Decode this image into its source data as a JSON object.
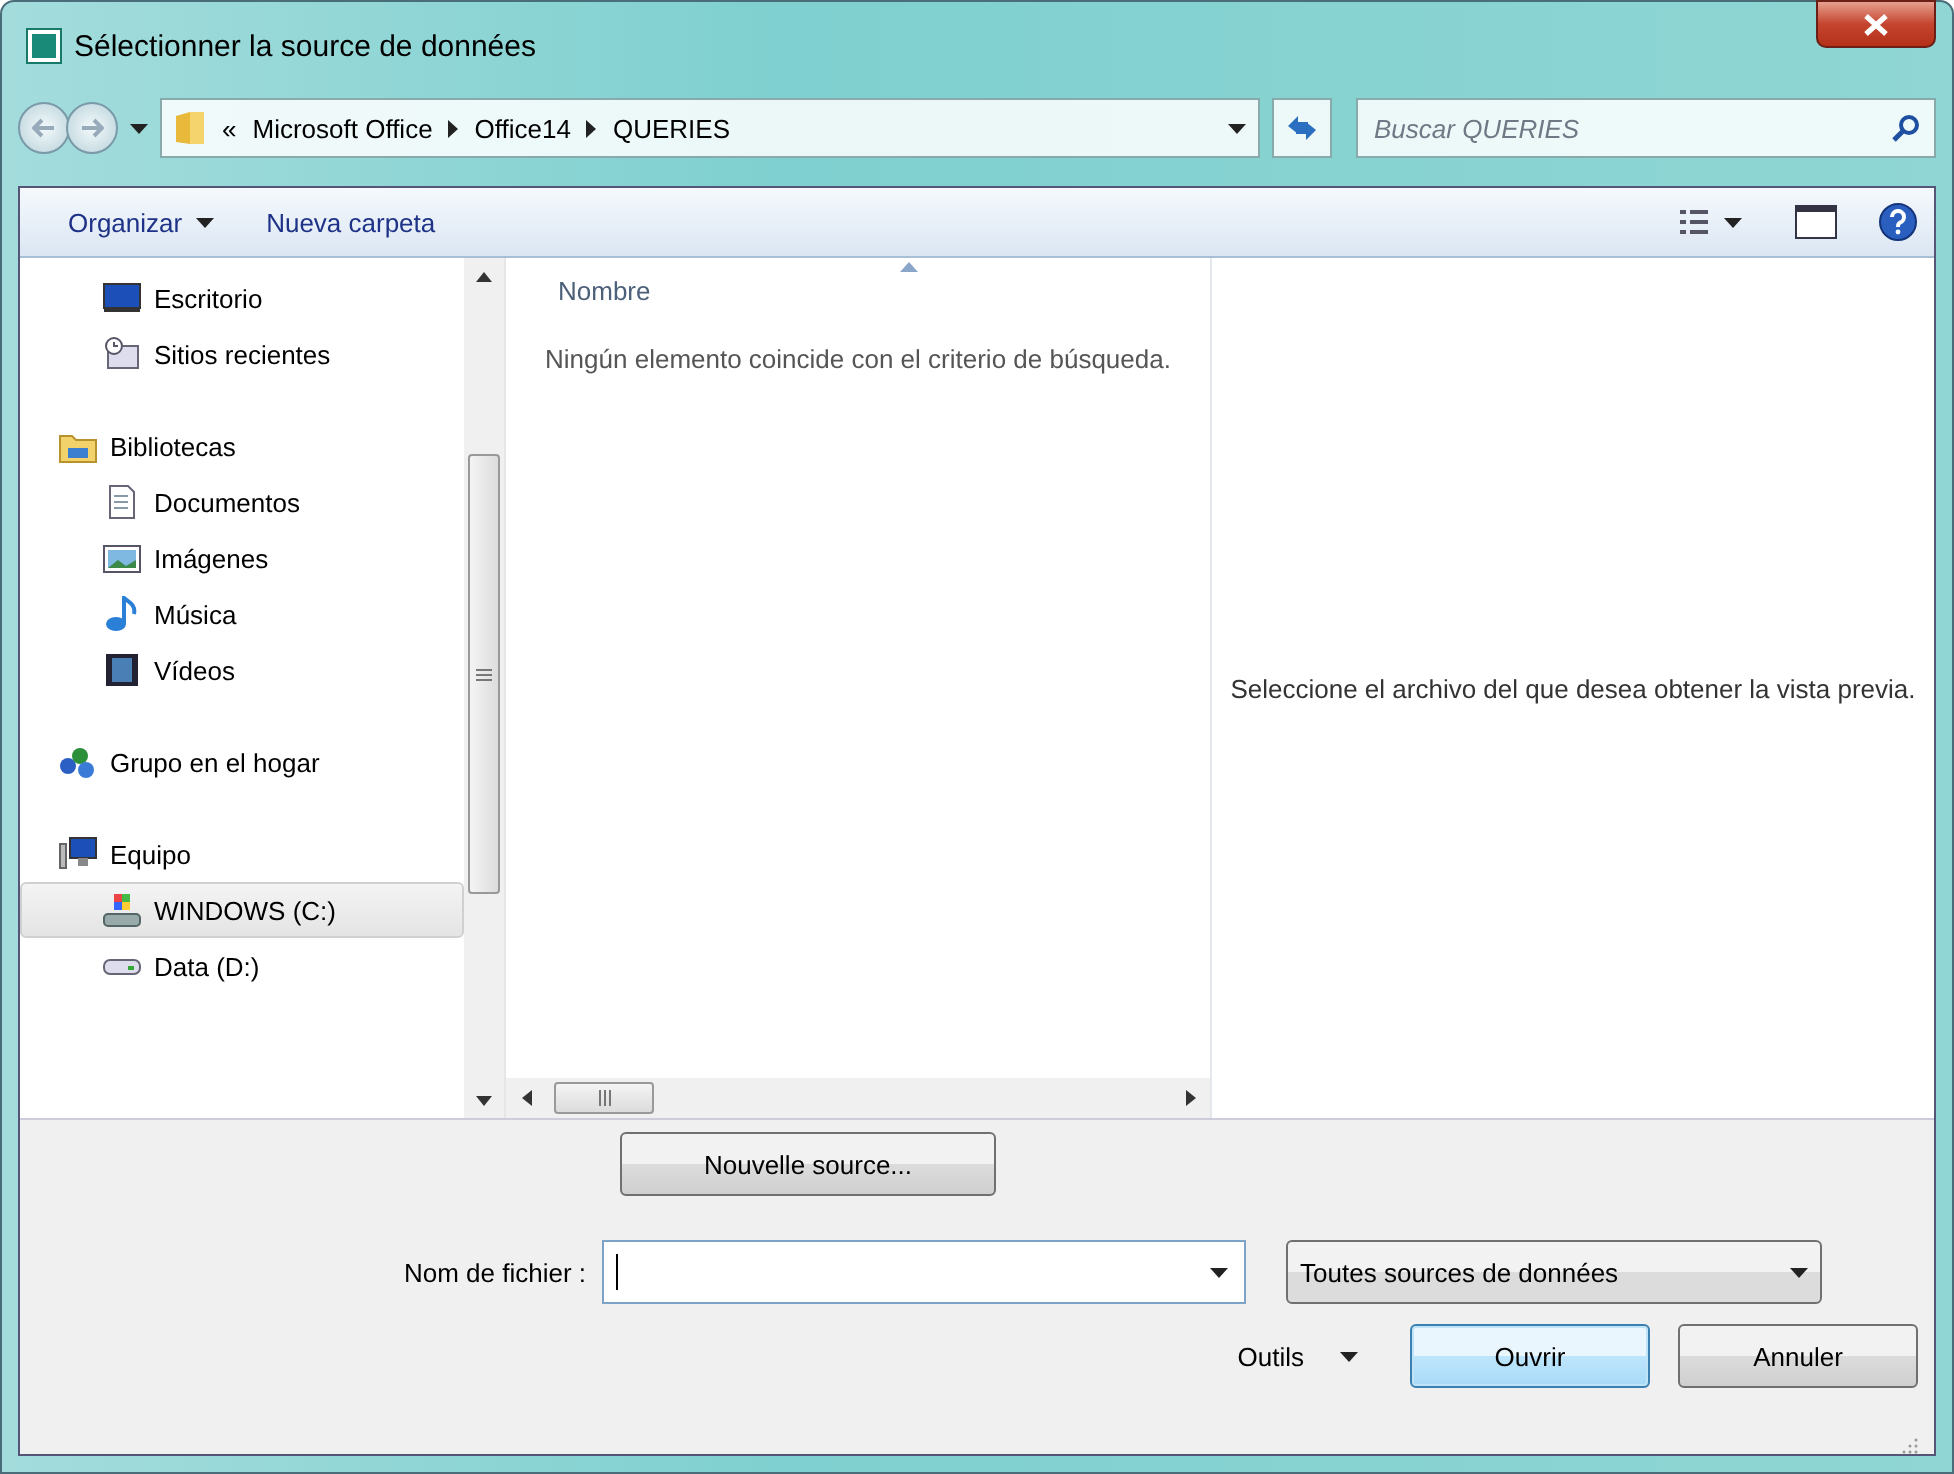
{
  "window": {
    "title": "Sélectionner la source de données"
  },
  "address": {
    "overflow": "«",
    "crumbs": [
      "Microsoft Office",
      "Office14",
      "QUERIES"
    ]
  },
  "search": {
    "placeholder": "Buscar QUERIES"
  },
  "toolbar": {
    "organize": "Organizar",
    "new_folder": "Nueva carpeta"
  },
  "nav": {
    "favorites": [
      {
        "label": "Escritorio",
        "kind": "desktop",
        "selected": false
      },
      {
        "label": "Sitios recientes",
        "kind": "recent",
        "selected": false
      }
    ],
    "tree": [
      {
        "label": "Bibliotecas",
        "kind": "library",
        "selected": false,
        "children": [
          {
            "label": "Documentos",
            "kind": "document",
            "selected": false
          },
          {
            "label": "Imágenes",
            "kind": "pictures",
            "selected": false
          },
          {
            "label": "Música",
            "kind": "music",
            "selected": false
          },
          {
            "label": "Vídeos",
            "kind": "videos",
            "selected": false
          }
        ]
      },
      {
        "label": "Grupo en el hogar",
        "kind": "homegroup",
        "selected": false
      },
      {
        "label": "Equipo",
        "kind": "computer",
        "selected": false,
        "children": [
          {
            "label": "WINDOWS (C:)",
            "kind": "system-drive",
            "selected": true
          },
          {
            "label": "Data (D:)",
            "kind": "drive",
            "selected": false
          }
        ]
      }
    ]
  },
  "file_list": {
    "columns": [
      "Nombre"
    ],
    "empty_message": "Ningún elemento coincide con el criterio de búsqueda."
  },
  "preview": {
    "message": "Seleccione el archivo del que desea obtener la vista previa."
  },
  "new_source_button": "Nouvelle source...",
  "file_name": {
    "label": "Nom de fichier :"
  },
  "file_type": {
    "value": "Toutes sources de données"
  },
  "tools": "Outils",
  "buttons": [
    {
      "label": "Ouvrir",
      "kind": "default"
    },
    {
      "label": "Annuler",
      "kind": "normal"
    }
  ]
}
